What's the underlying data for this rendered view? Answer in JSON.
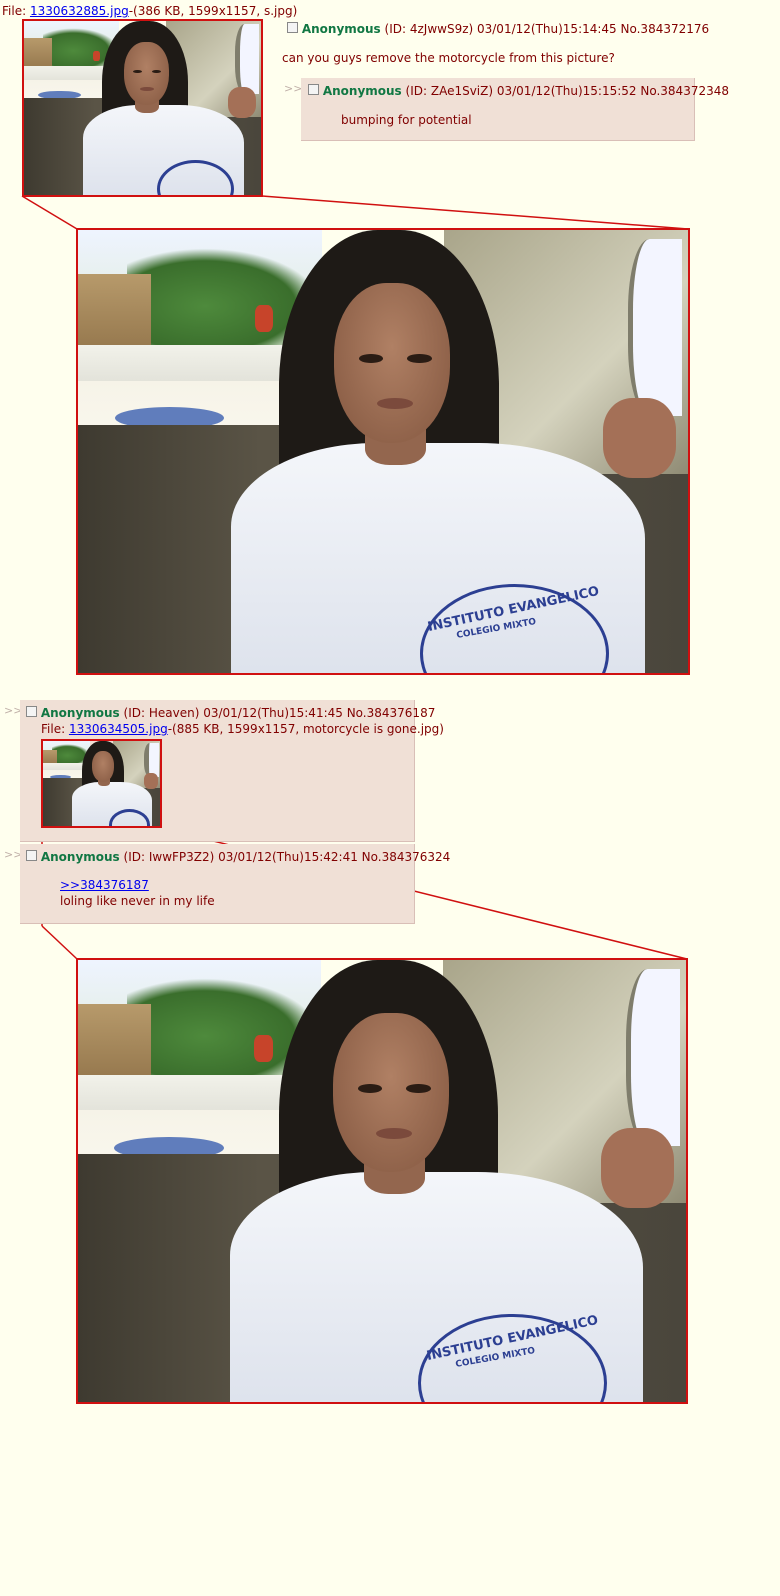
{
  "op": {
    "file_label": "File:",
    "file_link": "1330632885.jpg",
    "file_info": "-(386 KB, 1599x1157, s.jpg)",
    "name": "Anonymous",
    "meta": "(ID: 4zJwwS9z) 03/01/12(Thu)15:14:45 No.384372176",
    "comment": "can you guys remove the motorcycle from this picture?"
  },
  "reply1": {
    "arrows": ">>",
    "name": "Anonymous",
    "meta": "(ID: ZAe1SviZ) 03/01/12(Thu)15:15:52 No.384372348",
    "comment": "bumping for potential"
  },
  "reply2": {
    "arrows": ">>",
    "name": "Anonymous",
    "meta": "(ID: Heaven) 03/01/12(Thu)15:41:45 No.384376187",
    "file_label": "File:",
    "file_link": "1330634505.jpg",
    "file_info": "-(885 KB, 1599x1157, motorcycle is gone.jpg)"
  },
  "reply3": {
    "arrows": ">>",
    "name": "Anonymous",
    "meta": "(ID: IwwFP3Z2) 03/01/12(Thu)15:42:41 No.384376324",
    "quote_link": ">>384376187",
    "comment": "loling like never in my life"
  },
  "shirt_print": {
    "line1": "INSTITUTO EVANGELICO",
    "line2": "COLEGIO MIXTO"
  },
  "colors": {
    "background": "#ffffee",
    "reply_bg": "#f0e0d6",
    "name": "#117743",
    "link": "#0000ee",
    "border_highlight": "#d01010"
  }
}
